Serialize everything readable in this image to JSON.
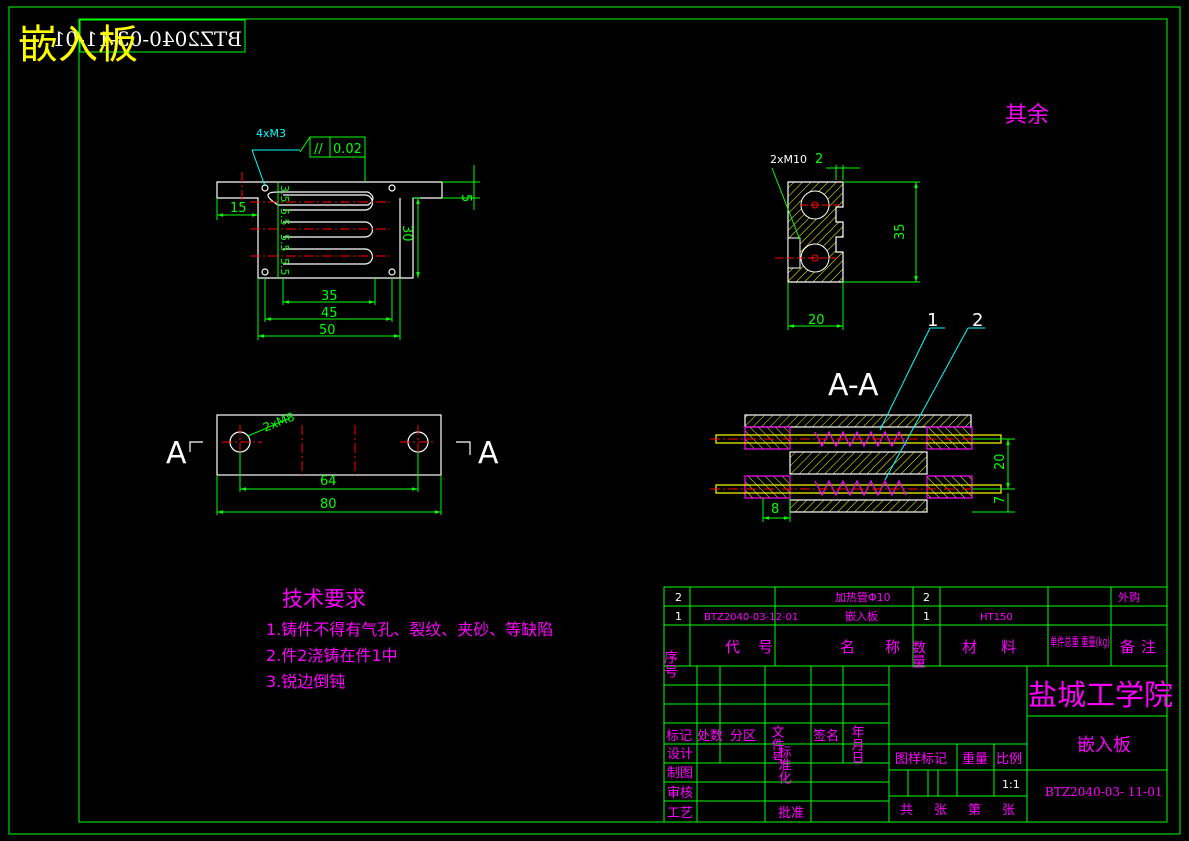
{
  "title_overlay": "嵌入板",
  "mirrored_code": "BTZ2040-03-11-01",
  "roughness_note": "其余",
  "colors": {
    "frame": "#00ff00",
    "outline": "#ffffff",
    "dimension": "#00ff00",
    "center_line": "#ff0000",
    "hatch": "#ffff00",
    "label_cyan": "#00ffff",
    "text_magenta": "#ff00ff",
    "title_yellow": "#ffff00"
  },
  "view_top": {
    "callout_holes": "4xM3",
    "flatness": "0.02",
    "flatness_symbol": "//",
    "dims": {
      "d15": "15",
      "d5": "5",
      "d30": "30",
      "d35": "35",
      "d45": "45",
      "d50": "50",
      "d3_5": "3.5",
      "d5_5a": "5.5",
      "d5_5b": "5.5",
      "d5_5c": "5.5"
    }
  },
  "view_bottom": {
    "callout": "2xM8",
    "dims": {
      "d64": "64",
      "d80": "80"
    },
    "section_left": "A",
    "section_right": "A"
  },
  "view_side": {
    "callout": "2xM10",
    "dims": {
      "d2": "2",
      "d35": "35",
      "d20": "20"
    }
  },
  "view_section": {
    "label": "A-A",
    "balloons": [
      "1",
      "2"
    ],
    "dims": {
      "d20": "20",
      "d7": "7",
      "d8": "8"
    }
  },
  "tech_req": {
    "heading": "技术要求",
    "items": [
      "1.铸件不得有气孔、裂纹、夹砂、等缺陷",
      "2.件2浇铸在件1中",
      "3.锐边倒钝"
    ]
  },
  "bom": {
    "rows": [
      {
        "seq": "2",
        "code": "",
        "name": "加热管Φ10",
        "qty": "2",
        "material": "",
        "weight": "",
        "note": "外购"
      },
      {
        "seq": "1",
        "code": "BTZ2040-03-12-01",
        "name": "嵌入板",
        "qty": "1",
        "material": "HT150",
        "weight": "",
        "note": ""
      }
    ],
    "header": {
      "seq": "序号",
      "code": "代号",
      "name": "名称",
      "qty": "数量",
      "material": "材料",
      "weight": "单件总重 重量(kg)",
      "note": "备注"
    }
  },
  "title_block": {
    "school": "盐城工学院",
    "part_name": "嵌入板",
    "drawing_no": "BTZ2040-03- 11-01",
    "labels": {
      "mark": "标记",
      "count": "处数",
      "zone": "分区",
      "doc": "文件号",
      "sign": "签名",
      "date": "年月日",
      "design": "设计",
      "standard": "标准化",
      "drawing": "制图",
      "review": "审核",
      "process": "工艺",
      "approve": "批准",
      "stage": "图样标记",
      "weight": "重量",
      "scale": "比例",
      "scale_value": "1:1",
      "sheets": "共　张　第　张"
    }
  }
}
